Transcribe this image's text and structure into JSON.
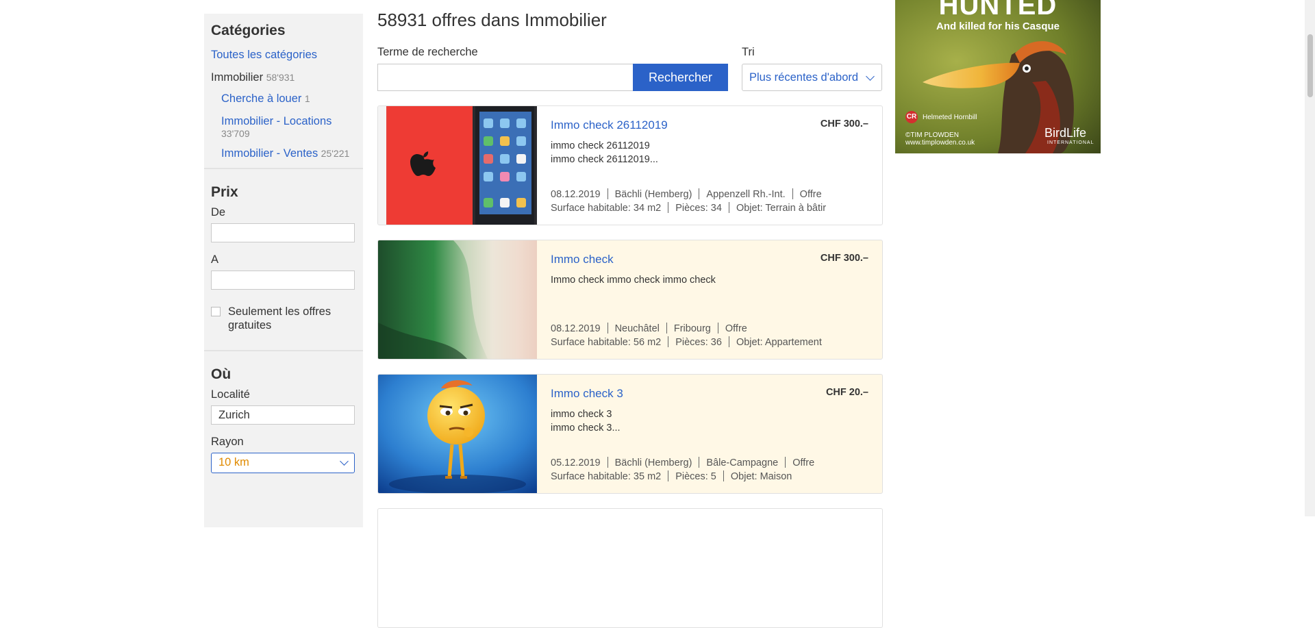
{
  "sidebar": {
    "categories_heading": "Catégories",
    "all_categories": "Toutes les catégories",
    "current_category": {
      "label": "Immobilier",
      "count": "58'931"
    },
    "subcategories": [
      {
        "label": "Cherche à louer",
        "count": "1"
      },
      {
        "label": "Immobilier - Locations",
        "count": "33'709"
      },
      {
        "label": "Immobilier - Ventes",
        "count": "25'221"
      }
    ],
    "price_heading": "Prix",
    "price_from_label": "De",
    "price_to_label": "A",
    "free_only_label_1": "Seulement les offres",
    "free_only_label_2": "gratuites",
    "where_heading": "Où",
    "locality_label": "Localité",
    "locality_value": "Zurich",
    "radius_label": "Rayon",
    "radius_value": "10 km"
  },
  "main": {
    "title": "58931 offres dans Immobilier",
    "search_label": "Terme de recherche",
    "search_value": "",
    "search_button": "Rechercher",
    "sort_label": "Tri",
    "sort_value": "Plus récentes d'abord"
  },
  "listings": [
    {
      "title": "Immo check 26112019",
      "price": "CHF 300.–",
      "desc_1": "immo check 26112019",
      "desc_2": "immo check 26112019...",
      "date": "08.12.2019",
      "place": "Bächli (Hemberg)",
      "region": "Appenzell Rh.-Int.",
      "type": "Offre",
      "surface": "Surface habitable: 34 m2",
      "rooms": "Pièces: 34",
      "object": "Objet: Terrain à bâtir",
      "image": "red-tablet"
    },
    {
      "title": "Immo check",
      "price": "CHF 300.–",
      "desc_1": "Immo check immo check immo check",
      "desc_2": "",
      "date": "08.12.2019",
      "place": "Neuchâtel",
      "region": "Fribourg",
      "type": "Offre",
      "surface": "Surface habitable: 56 m2",
      "rooms": "Pièces: 36",
      "object": "Objet: Appartement",
      "image": "green-wave"
    },
    {
      "title": "Immo check 3",
      "price": "CHF 20.–",
      "desc_1": "immo check 3",
      "desc_2": "immo check 3...",
      "date": "05.12.2019",
      "place": "Bächli (Hemberg)",
      "region": "Bâle-Campagne",
      "type": "Offre",
      "surface": "Surface habitable: 35 m2",
      "rooms": "Pièces: 5",
      "object": "Objet: Maison",
      "image": "emoji-character"
    }
  ],
  "ad": {
    "headline": "HUNTED",
    "subline": "And killed for his Casque",
    "species": "Helmeted Hornbill",
    "badge": "CR",
    "credit_1": "©TIM PLOWDEN",
    "credit_2": "www.timplowden.co.uk",
    "brand": "BirdLife",
    "brand_sub": "INTERNATIONAL"
  },
  "colors": {
    "accent": "#2b62c8",
    "highlight_bg": "#fff8e6",
    "sidebar_bg": "#f2f2f2",
    "orange_value": "#e08a00"
  }
}
